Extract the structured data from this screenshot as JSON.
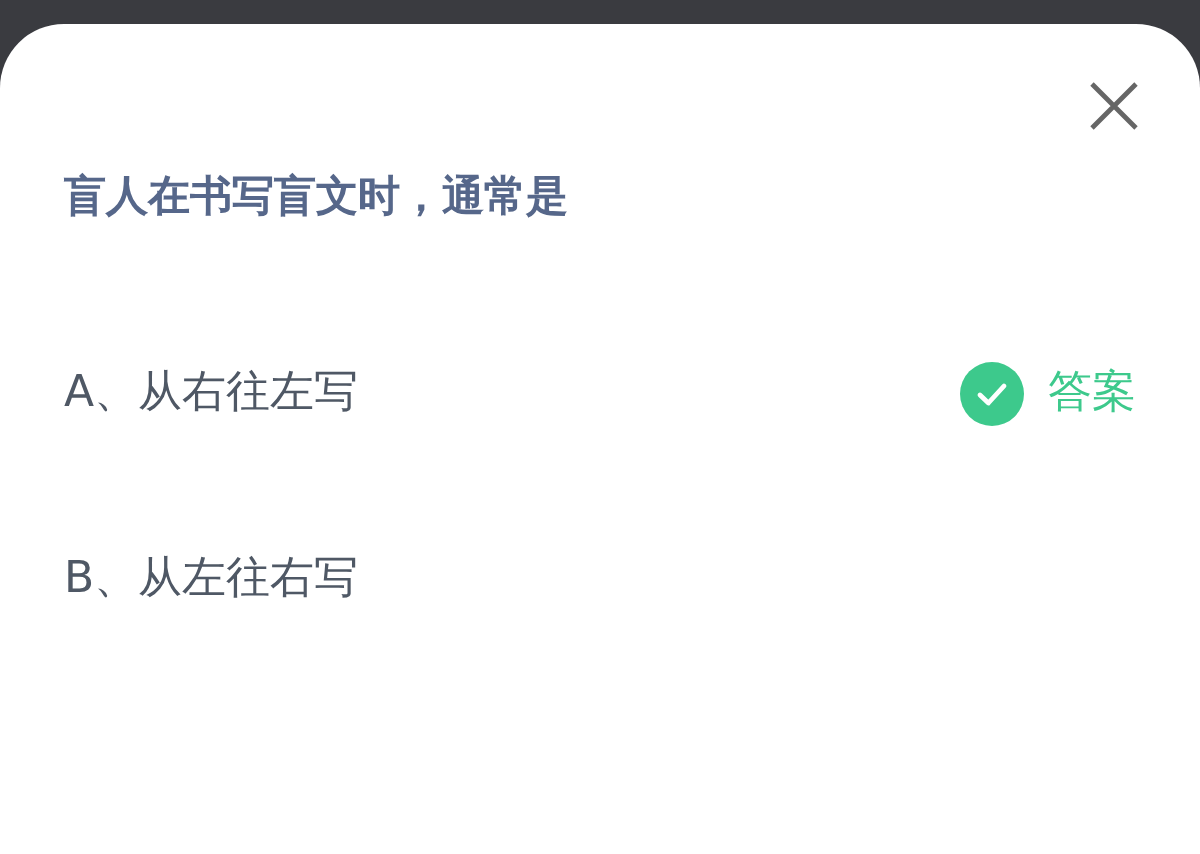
{
  "question": "盲人在书写盲文时，通常是",
  "options": [
    {
      "text": "A、从右往左写",
      "correct": true
    },
    {
      "text": "B、从左往右写",
      "correct": false
    }
  ],
  "answer_label": "答案"
}
